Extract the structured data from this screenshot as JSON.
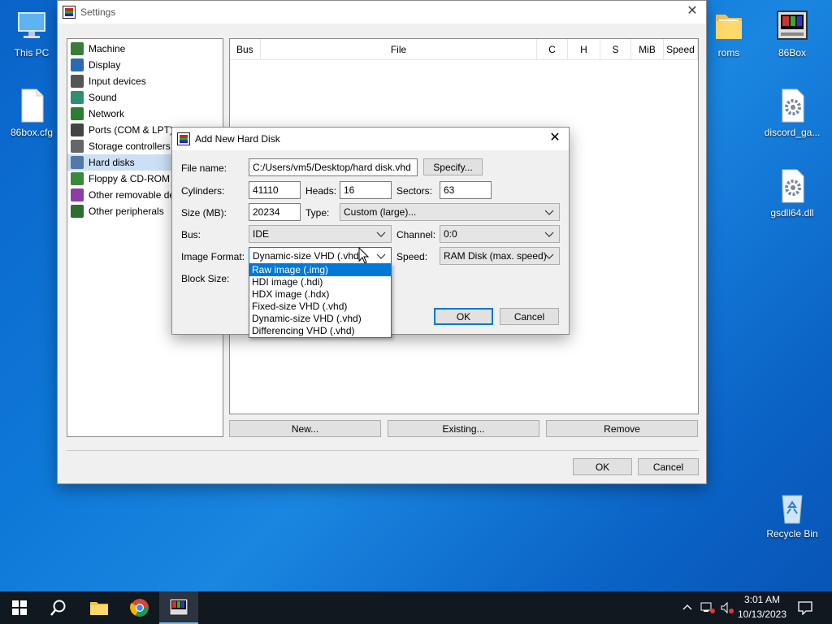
{
  "desktop": {
    "icons_left": [
      {
        "label": "This PC"
      },
      {
        "label": "86box.cfg"
      }
    ],
    "icons_right": [
      {
        "label": "roms"
      },
      {
        "label": "86Box"
      },
      {
        "label": "discord_ga..."
      },
      {
        "label": "gsdll64.dll"
      },
      {
        "label": "Recycle Bin"
      }
    ]
  },
  "settings": {
    "title": "Settings",
    "sidebar": [
      {
        "label": "Machine",
        "color": "#3a7d3a"
      },
      {
        "label": "Display",
        "color": "#2b6cb0"
      },
      {
        "label": "Input devices",
        "color": "#555555"
      },
      {
        "label": "Sound",
        "color": "#2f8f6f"
      },
      {
        "label": "Network",
        "color": "#2e7d32"
      },
      {
        "label": "Ports (COM & LPT)",
        "color": "#444444"
      },
      {
        "label": "Storage controllers",
        "color": "#666666"
      },
      {
        "label": "Hard disks",
        "color": "#5577aa"
      },
      {
        "label": "Floppy & CD-ROM",
        "color": "#3b8a3b"
      },
      {
        "label": "Other removable de",
        "color": "#8a3fa5"
      },
      {
        "label": "Other peripherals",
        "color": "#2e6e2e"
      }
    ],
    "selected_index": 7,
    "table_headers": [
      "Bus",
      "File",
      "C",
      "H",
      "S",
      "MiB",
      "Speed"
    ],
    "buttons": {
      "new": "New...",
      "existing": "Existing...",
      "remove": "Remove",
      "ok": "OK",
      "cancel": "Cancel"
    }
  },
  "dialog": {
    "title": "Add New Hard Disk",
    "labels": {
      "file_name": "File name:",
      "cylinders": "Cylinders:",
      "heads": "Heads:",
      "sectors": "Sectors:",
      "size": "Size (MB):",
      "type": "Type:",
      "bus": "Bus:",
      "channel": "Channel:",
      "image_format": "Image Format:",
      "speed": "Speed:",
      "block_size": "Block Size:"
    },
    "values": {
      "file_name": "C:/Users/vm5/Desktop/hard disk.vhd",
      "cylinders": "41110",
      "heads": "16",
      "sectors": "63",
      "size": "20234",
      "type": "Custom (large)...",
      "bus": "IDE",
      "channel": "0:0",
      "image_format": "Dynamic-size VHD (.vhd)",
      "speed": "RAM Disk (max. speed)"
    },
    "buttons": {
      "specify": "Specify...",
      "ok": "OK",
      "cancel": "Cancel"
    },
    "image_format_options": [
      "Raw image (.img)",
      "HDI image (.hdi)",
      "HDX image (.hdx)",
      "Fixed-size VHD (.vhd)",
      "Dynamic-size VHD (.vhd)",
      "Differencing VHD (.vhd)"
    ],
    "highlighted_option": 0
  },
  "taskbar": {
    "time": "3:01 AM",
    "date": "10/13/2023",
    "accent": "#0078d7"
  }
}
